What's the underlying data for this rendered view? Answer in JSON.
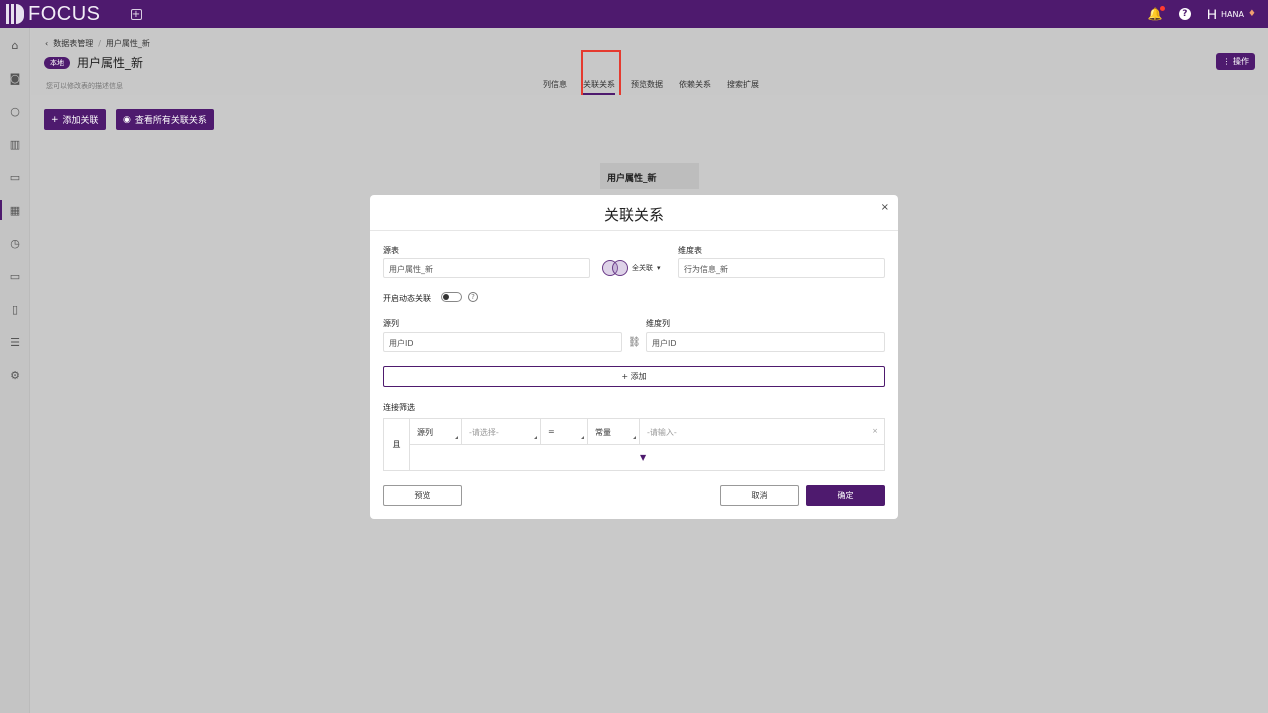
{
  "app": {
    "logo_text": "FOCUS",
    "new_tab_icon": "+"
  },
  "topbar": {
    "user_initial": "H",
    "user_name": "HANA"
  },
  "breadcrumb": {
    "parent": "数据表管理",
    "separator": "/",
    "current": "用户属性_新"
  },
  "page": {
    "badge": "本地",
    "title": "用户属性_新",
    "description": "您可以修改表的描述信息",
    "ops_label": "⋮ 操作"
  },
  "tabs": [
    {
      "label": "列信息"
    },
    {
      "label": "关联关系",
      "active": true
    },
    {
      "label": "预览数据"
    },
    {
      "label": "依赖关系"
    },
    {
      "label": "搜索扩展"
    }
  ],
  "actions": {
    "add_relation": "添加关联",
    "view_all": "查看所有关联关系"
  },
  "graph_node": {
    "label": "用户属性_新"
  },
  "modal": {
    "title": "关联关系",
    "close": "×",
    "source_table_label": "源表",
    "source_table_value": "用户属性_新",
    "join_type": "全关联",
    "dimension_table_label": "维度表",
    "dimension_table_value": "行为信息_新",
    "dynamic_join_label": "开启动态关联",
    "help": "?",
    "source_column_label": "源列",
    "source_column_value": "用户ID",
    "dimension_column_label": "维度列",
    "dimension_column_value": "用户ID",
    "add_label": "+ 添加",
    "filter_label": "连接筛选",
    "filter": {
      "conjunction": "且",
      "column_type": "源列",
      "column_placeholder": "-请选择-",
      "operator": "=",
      "value_type": "常量",
      "value_placeholder": "-请输入-",
      "clear": "×",
      "expand": "▼"
    },
    "preview_label": "预览",
    "cancel_label": "取消",
    "confirm_label": "确定"
  },
  "colors": {
    "brand": "#4e1a6e",
    "highlight": "#e53a2f"
  }
}
